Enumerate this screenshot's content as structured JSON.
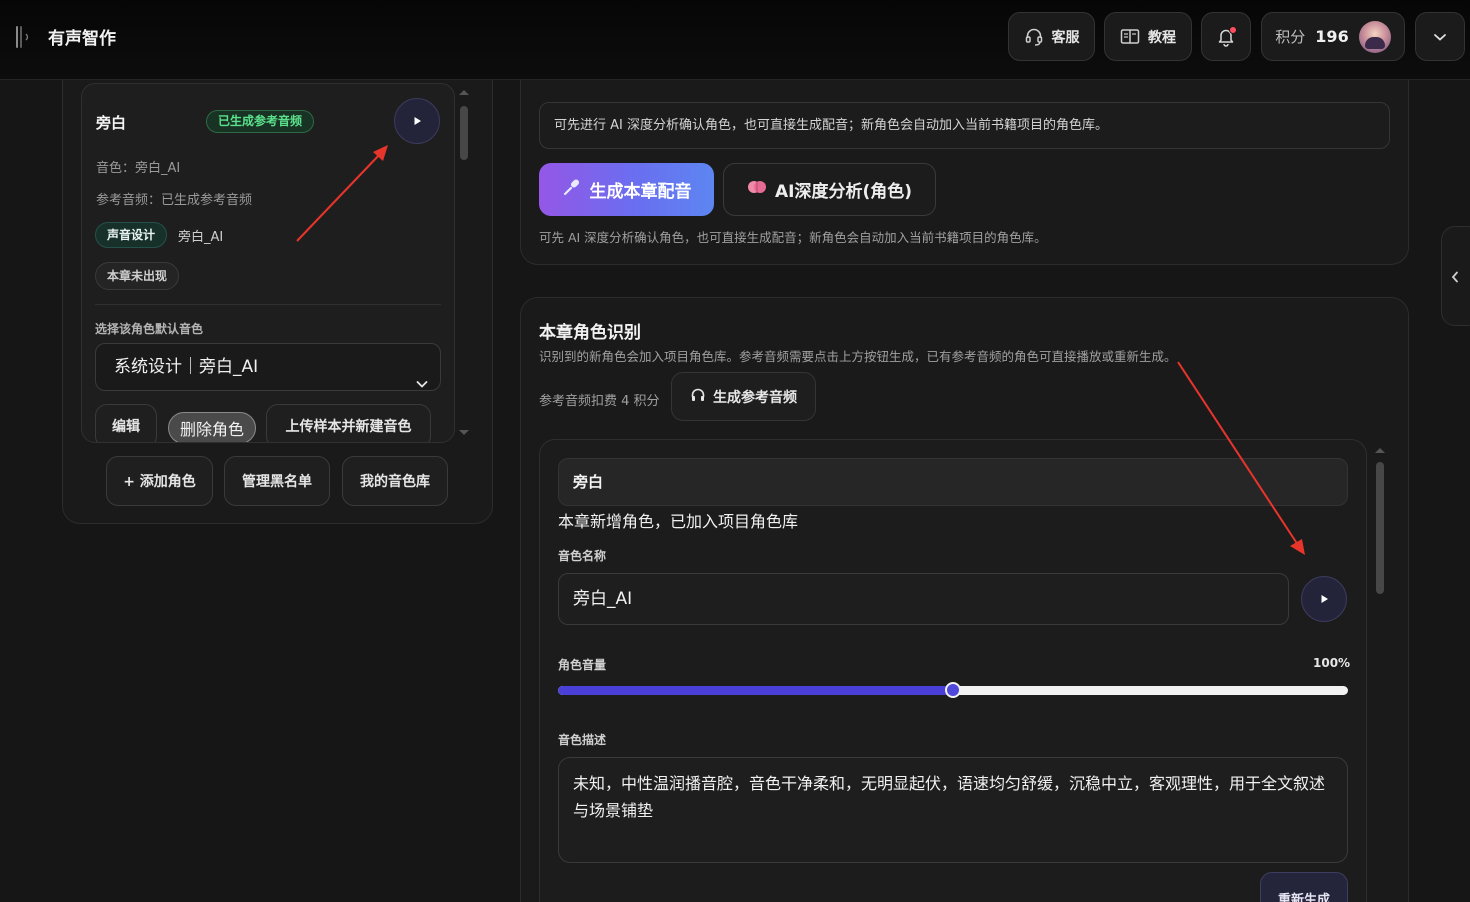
{
  "app": {
    "title": "有声智作"
  },
  "topbar": {
    "support_label": "客服",
    "tutorial_label": "教程",
    "credits_label": "积分",
    "credits_value": "196"
  },
  "left_panel": {
    "character": {
      "name": "旁白",
      "status_badge": "已生成参考音频",
      "voice_line": "音色：旁白_AI",
      "reference_line": "参考音频：已生成参考音频",
      "design_tag": "声音设计",
      "design_voice": "旁白_AI",
      "absent_tag": "本章未出现",
      "default_voice_label": "选择该角色默认音色",
      "selected_voice": "系统设计｜旁白_AI",
      "edit_label": "编辑",
      "delete_label": "删除角色",
      "upload_label": "上传样本并新建音色"
    },
    "actions": {
      "add_label": "+ 添加角色",
      "blacklist_label": "管理黑名单",
      "library_label": "我的音色库"
    }
  },
  "right_top": {
    "hint_text": "可先进行 AI 深度分析确认角色，也可直接生成配音；新角色会自动加入当前书籍项目的角色库。",
    "generate_label": "生成本章配音",
    "analyze_label": "AI深度分析(角色)",
    "note_text": "可先 AI 深度分析确认角色，也可直接生成配音；新角色会自动加入当前书籍项目的角色库。"
  },
  "right_main": {
    "title": "本章角色识别",
    "subtitle": "识别到的新角色会加入项目角色库。参考音频需要点击上方按钮生成，已有参考音频的角色可直接播放或重新生成。",
    "cost_note": "参考音频扣费 4 积分",
    "ref_button_label": "生成参考音频",
    "character": {
      "name": "旁白",
      "added_note": "本章新增角色，已加入项目角色库",
      "voice_name_label": "音色名称",
      "voice_name_value": "旁白_AI",
      "volume_label": "角色音量",
      "volume_value": "100%",
      "volume_level": 0.5,
      "desc_label": "音色描述",
      "desc_value": "未知，中性温润播音腔，音色干净柔和，无明显起伏，语速均匀舒缓，沉稳中立，客观理性，用于全文叙述与场景铺垫",
      "regen_label": "重新生成"
    }
  },
  "colors": {
    "accent": "#4a3fd6",
    "success": "#5be08c",
    "annotation_arrow": "#e8352b"
  }
}
